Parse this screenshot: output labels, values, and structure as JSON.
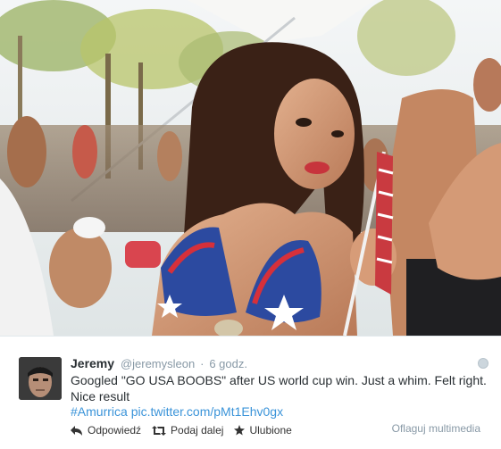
{
  "tweet": {
    "name": "Jeremy",
    "handle": "@jeremysleon",
    "separator": "·",
    "time": "6 godz.",
    "text": "Googled \"GO USA BOOBS\" after US world cup win. Just a whim. Felt right. Nice result",
    "hashtag": "#Amurrica",
    "pic_link": "pic.twitter.com/pMt1Ehv0gx"
  },
  "actions": {
    "reply": "Odpowiedź",
    "retweet": "Podaj dalej",
    "favorite": "Ulubione",
    "flag": "Oflaguj multimedia"
  },
  "icons": {
    "reply": "reply-icon",
    "retweet": "retweet-icon",
    "favorite": "star-icon",
    "more": "more-icon"
  },
  "colors": {
    "link": "#3b94d9",
    "muted": "#8899a6",
    "text": "#292f33"
  }
}
